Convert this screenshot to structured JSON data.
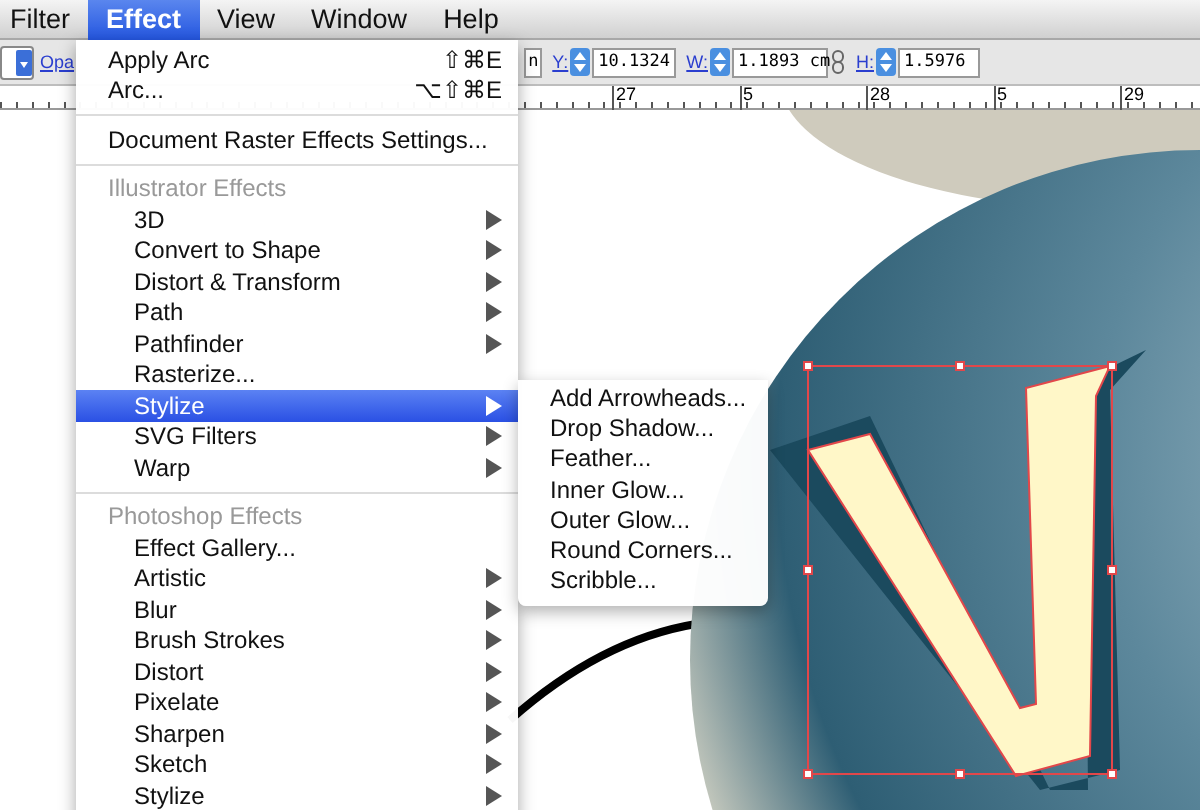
{
  "menubar": [
    {
      "label": "Filter",
      "selected": false
    },
    {
      "label": "Effect",
      "selected": true
    },
    {
      "label": "View",
      "selected": false
    },
    {
      "label": "Window",
      "selected": false
    },
    {
      "label": "Help",
      "selected": false
    }
  ],
  "toolbar": {
    "opacity_label": "Opa",
    "partial_field": "n",
    "fields": [
      {
        "label": "Y:",
        "value": "10.1324"
      },
      {
        "label": "W:",
        "value": "1.1893 cm",
        "linked": true
      },
      {
        "label": "H:",
        "value": "1.5976"
      }
    ]
  },
  "ruler": [
    "27",
    "5",
    "28",
    "5",
    "29"
  ],
  "menu": {
    "items": [
      {
        "kind": "item",
        "label": "Apply Arc",
        "shortcut": "⇧⌘E",
        "submenu": false,
        "selected": false
      },
      {
        "kind": "item",
        "label": "Arc...",
        "shortcut": "⌥⇧⌘E",
        "submenu": false,
        "selected": false
      },
      {
        "kind": "separator"
      },
      {
        "kind": "item",
        "label": "Document Raster Effects Settings...",
        "submenu": false,
        "selected": false
      },
      {
        "kind": "separator"
      },
      {
        "kind": "header",
        "label": "Illustrator Effects"
      },
      {
        "kind": "item",
        "label": "3D",
        "submenu": true,
        "selected": false
      },
      {
        "kind": "item",
        "label": "Convert to Shape",
        "submenu": true,
        "selected": false
      },
      {
        "kind": "item",
        "label": "Distort & Transform",
        "submenu": true,
        "selected": false
      },
      {
        "kind": "item",
        "label": "Path",
        "submenu": true,
        "selected": false
      },
      {
        "kind": "item",
        "label": "Pathfinder",
        "submenu": true,
        "selected": false
      },
      {
        "kind": "item",
        "label": "Rasterize...",
        "submenu": false,
        "selected": false
      },
      {
        "kind": "item",
        "label": "Stylize",
        "submenu": true,
        "selected": true
      },
      {
        "kind": "item",
        "label": "SVG Filters",
        "submenu": true,
        "selected": false
      },
      {
        "kind": "item",
        "label": "Warp",
        "submenu": true,
        "selected": false
      },
      {
        "kind": "separator"
      },
      {
        "kind": "header",
        "label": "Photoshop Effects"
      },
      {
        "kind": "item",
        "label": "Effect Gallery...",
        "submenu": false,
        "selected": false
      },
      {
        "kind": "item",
        "label": "Artistic",
        "submenu": true,
        "selected": false
      },
      {
        "kind": "item",
        "label": "Blur",
        "submenu": true,
        "selected": false
      },
      {
        "kind": "item",
        "label": "Brush Strokes",
        "submenu": true,
        "selected": false
      },
      {
        "kind": "item",
        "label": "Distort",
        "submenu": true,
        "selected": false
      },
      {
        "kind": "item",
        "label": "Pixelate",
        "submenu": true,
        "selected": false
      },
      {
        "kind": "item",
        "label": "Sharpen",
        "submenu": true,
        "selected": false
      },
      {
        "kind": "item",
        "label": "Sketch",
        "submenu": true,
        "selected": false
      },
      {
        "kind": "item",
        "label": "Stylize",
        "submenu": true,
        "selected": false
      }
    ]
  },
  "submenu": {
    "items": [
      "Add Arrowheads...",
      "Drop Shadow...",
      "Feather...",
      "Inner Glow...",
      "Outer Glow...",
      "Round Corners...",
      "Scribble..."
    ]
  }
}
